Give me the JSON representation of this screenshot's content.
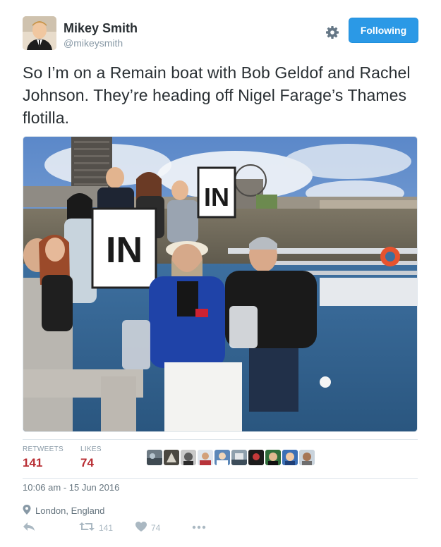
{
  "user": {
    "name": "Mikey Smith",
    "handle": "@mikeysmith"
  },
  "header": {
    "follow_label": "Following",
    "gear_icon": "gear-icon"
  },
  "tweet": {
    "text": "So I’m on a Remain boat with Bob Geldof and Rachel Johnson. They’re heading off Nigel Farage’s Thames flotilla.",
    "photo_sign_text": "IN"
  },
  "stats": {
    "retweets_label": "RETWEETS",
    "retweets_count": "141",
    "likes_label": "LIKES",
    "likes_count": "74"
  },
  "meta": {
    "timestamp": "10:06 am - 15 Jun 2016",
    "location": "London, England"
  },
  "actions": {
    "reply_icon": "reply-icon",
    "retweet_count": "141",
    "like_count": "74",
    "more_icon": "more-icon"
  },
  "colors": {
    "follow_blue": "#2b99e6",
    "stat_red": "#b82d33",
    "muted": "#8899a6"
  }
}
